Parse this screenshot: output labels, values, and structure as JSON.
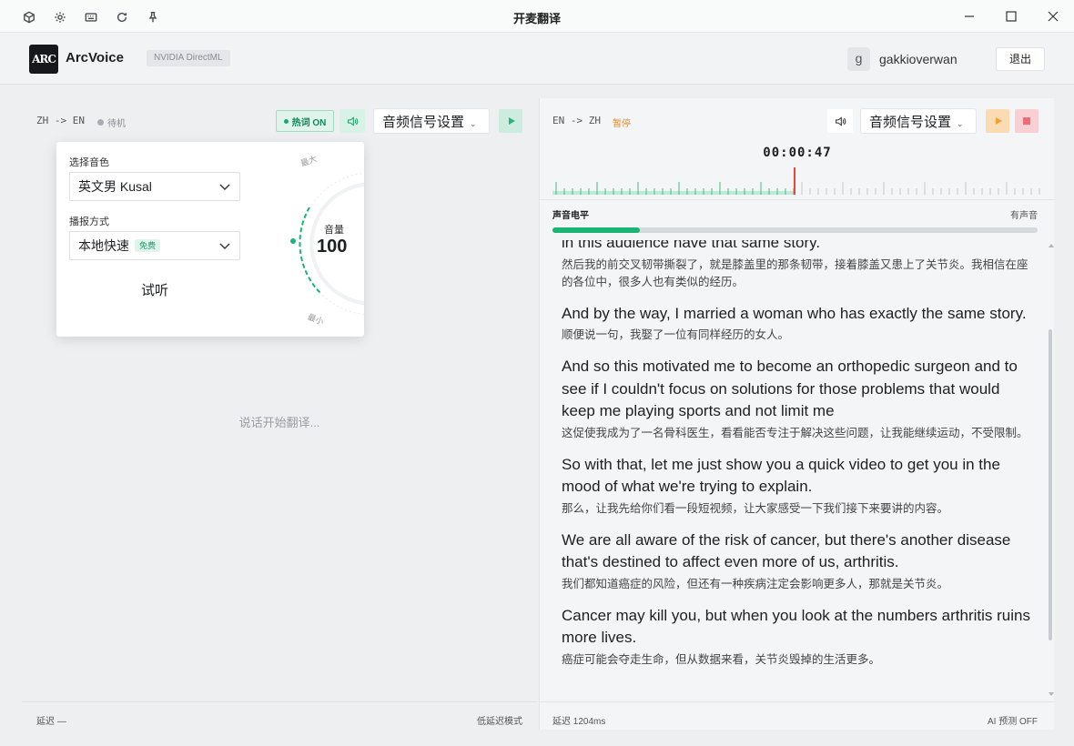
{
  "window": {
    "title": "开麦翻译",
    "toolbar_icons": [
      "cube-icon",
      "gear-icon",
      "keyboard-icon",
      "refresh-icon",
      "pin-icon"
    ]
  },
  "header": {
    "logo_text": "ARC",
    "app_name": "ArcVoice",
    "gpu_badge": "NVIDIA DirectML",
    "avatar_letter": "g",
    "username": "gakkioverwan",
    "logout_label": "退出"
  },
  "left_panel": {
    "direction": "ZH -> EN",
    "status": "待机",
    "hot_words": "热词 ON",
    "audio_settings": "音频信号设置",
    "placeholder": "说话开始翻译...",
    "footer_left": "延迟 —",
    "footer_right": "低延迟模式",
    "popover": {
      "voice_label": "选择音色",
      "voice_value": "英文男 Kusal",
      "mode_label": "播报方式",
      "mode_value": "本地快速",
      "mode_badge": "免费",
      "listen_label": "试听",
      "volume_label": "音量",
      "volume_value": "100",
      "max_label": "最大",
      "min_label": "最小"
    }
  },
  "right_panel": {
    "direction": "EN -> ZH",
    "status": "暂停",
    "audio_settings": "音频信号设置",
    "timer": "00:00:47",
    "playhead_fraction": 0.46,
    "level_label": "声音电平",
    "level_status": "有声音",
    "level_fraction": 0.18,
    "footer_left": "延迟 1204ms",
    "footer_right": "AI 预测 OFF",
    "segments": [
      {
        "en": "in this audience have that same story.",
        "zh": "然后我的前交叉韧带撕裂了，就是膝盖里的那条韧带，接着膝盖又患上了关节炎。我相信在座的各位中，很多人也有类似的经历。"
      },
      {
        "en": "And by the way, I married a woman who has exactly the same story.",
        "zh": "顺便说一句，我娶了一位有同样经历的女人。"
      },
      {
        "en": "And so this motivated me to become an orthopedic surgeon and to see if I couldn't focus on solutions for those problems that would keep me playing sports and not limit me",
        "zh": "这促使我成为了一名骨科医生，看看能否专注于解决这些问题，让我能继续运动，不受限制。"
      },
      {
        "en": "So with that, let me just show you a quick video to get you in the mood of what we're trying to explain.",
        "zh": "那么，让我先给你们看一段短视频，让大家感受一下我们接下来要讲的内容。"
      },
      {
        "en": "We are all aware of the risk of cancer, but there's another disease that's destined to affect even more of us, arthritis.",
        "zh": "我们都知道癌症的风险，但还有一种疾病注定会影响更多人，那就是关节炎。"
      },
      {
        "en": "Cancer may kill you, but when you look at the numbers arthritis ruins more lives.",
        "zh": "癌症可能会夺走生命，但从数据来看，关节炎毁掉的生活更多。"
      }
    ]
  },
  "colors": {
    "accent_green": "#1ab575",
    "pause_orange": "#e28a2b",
    "stop_red": "#ef6b7a",
    "playhead_red": "#e8483c"
  }
}
